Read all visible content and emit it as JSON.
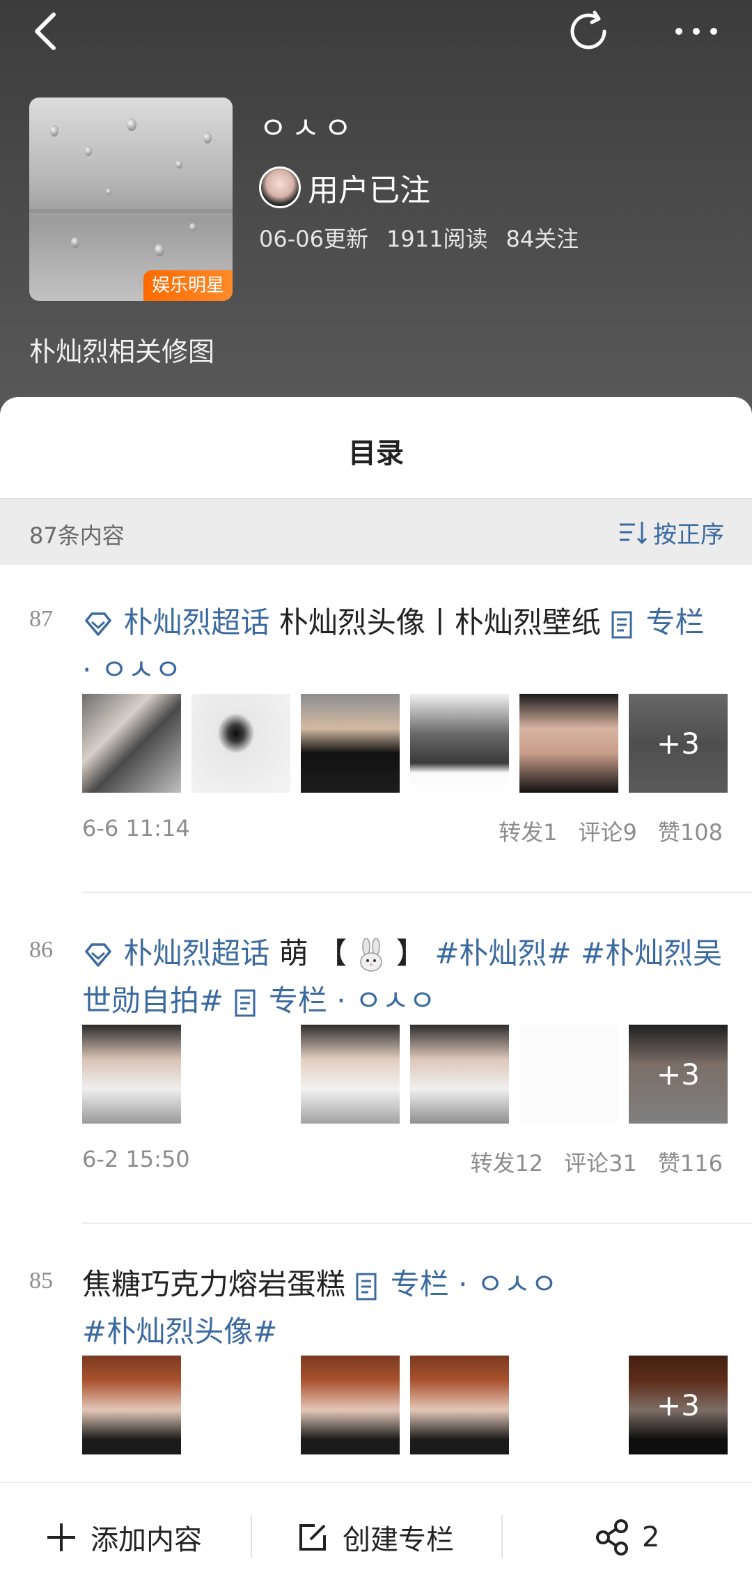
{
  "header": {
    "album_title": "ㅇㅅㅇ",
    "author_name": "用户已注",
    "stats": {
      "updated": "06-06更新",
      "reads": "1911阅读",
      "follows": "84关注"
    },
    "cover_badge": "娱乐明星",
    "description": "朴灿烈相关修图"
  },
  "sheet": {
    "title": "目录",
    "count": "87条内容",
    "sort_label": "按正序"
  },
  "items": [
    {
      "num": "87",
      "topic": "朴灿烈超话",
      "text": "朴灿烈头像丨朴灿烈壁纸",
      "column": "专栏 · ㅇㅅㅇ",
      "more": "+3",
      "time": "6-6 11:14",
      "repost": "转发1",
      "comment": "评论9",
      "like": "赞108"
    },
    {
      "num": "86",
      "topic": "朴灿烈超话",
      "text_a": "萌 【",
      "text_b": "】",
      "hashtags": "#朴灿烈# #朴灿烈吴世勋自拍#",
      "column": "专栏 · ㅇㅅㅇ",
      "more": "+3",
      "time": "6-2 15:50",
      "repost": "转发12",
      "comment": "评论31",
      "like": "赞116"
    },
    {
      "num": "85",
      "text": "焦糖巧克力熔岩蛋糕",
      "column": "专栏 · ㅇㅅㅇ",
      "hashtag": "#朴灿烈头像#",
      "more": "+3"
    }
  ],
  "bottom_bar": {
    "add_label": "添加内容",
    "create_label": "创建专栏",
    "share_count": "2"
  },
  "colors": {
    "link_blue": "#3b6aa0",
    "badge_orange": "#ff6a00"
  }
}
